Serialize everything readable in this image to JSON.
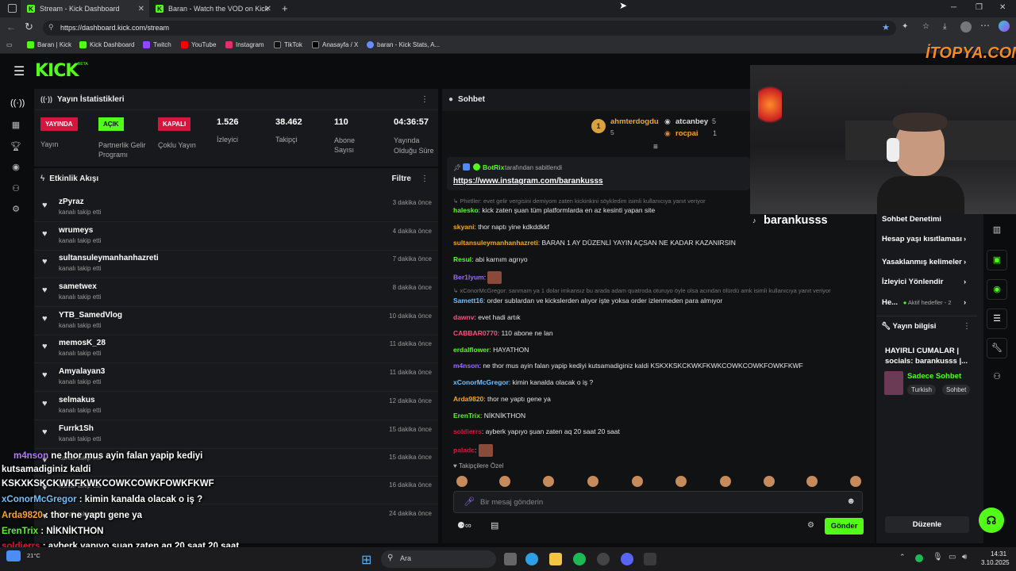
{
  "browser": {
    "tabs": [
      {
        "label": "Stream - Kick Dashboard"
      },
      {
        "label": "Baran - Watch the VOD on Kick"
      }
    ],
    "new_tab": "+",
    "url": "https://dashboard.kick.com/stream",
    "bookmarks": [
      "Baran | Kick",
      "Kick Dashboard",
      "Twitch",
      "YouTube",
      "Instagram",
      "TikTok",
      "Anasayfa / X",
      "baran - Kick Stats, A..."
    ]
  },
  "kick": {
    "logo": "KICK",
    "logo_sup": "BETA"
  },
  "stats_panel": {
    "title": "Yayın İstatistikleri",
    "items": [
      {
        "badge": "YAYINDA",
        "label": "Yayın",
        "color": "#d4153c"
      },
      {
        "badge": "AÇIK",
        "label": "Partnerlik Gelir Programı",
        "color": "#53fc18"
      },
      {
        "badge": "KAPALI",
        "label": "Çoklu Yayın",
        "color": "#d4153c"
      },
      {
        "value": "1.526",
        "label": "İzleyici"
      },
      {
        "value": "38.462",
        "label": "Takipçi"
      },
      {
        "value": "110",
        "label": "Abone Sayısı"
      },
      {
        "value": "04:36:57",
        "label": "Yayında Olduğu Süre"
      }
    ]
  },
  "activity": {
    "title": "Etkinlik Akışı",
    "filter": "Filtre",
    "sub": "kanalı takip etti",
    "items": [
      {
        "name": "zPyraz",
        "time": "3 dakika önce"
      },
      {
        "name": "wrumeys",
        "time": "4 dakika önce"
      },
      {
        "name": "sultansuleymanhanhazreti",
        "time": "7 dakika önce"
      },
      {
        "name": "sametwex",
        "time": "8 dakika önce"
      },
      {
        "name": "YTB_SamedVlog",
        "time": "10 dakika önce"
      },
      {
        "name": "memosK_28",
        "time": "11 dakika önce"
      },
      {
        "name": "Amyalayan3",
        "time": "11 dakika önce"
      },
      {
        "name": "selmakus",
        "time": "12 dakika önce"
      },
      {
        "name": "Furrk1Sh",
        "time": "15 dakika önce"
      },
      {
        "name": "",
        "time": "15 dakika önce"
      },
      {
        "name": "",
        "time": "16 dakika önce"
      },
      {
        "name": "",
        "time": "24 dakika önce"
      }
    ]
  },
  "chat": {
    "title": "Sohbet",
    "top": [
      {
        "rank": "1",
        "name": "ahmterdogdu",
        "count": "5"
      },
      {
        "name": "atcanbey",
        "count": "5"
      },
      {
        "name": "rocpai",
        "count": "1"
      }
    ],
    "pinned_by": "BotRix",
    "pinned_suffix": "tarafından sabitlendi",
    "pinned_link": "https://www.instagram.com/barankusss",
    "messages": [
      {
        "type": "reply",
        "text": "Phirtller: evet gelir vergisini demiyom zaten kickinkini söykledim isimli kullanıcıya yanıt veriyor"
      },
      {
        "user": "halesko",
        "color": "#53fc18",
        "text": "kick zaten şuan tüm platformlarda en az kesinti yapan site"
      },
      {
        "user": "skyani",
        "color": "#f5a623",
        "text": "thor naptı yine kdkddkkf"
      },
      {
        "user": "sultansuleymanhanhazreti",
        "color": "#f5a623",
        "text": "BARAN 1 AY DÜZENLİ YAYIN AÇSAN NE KADAR KAZANIRSIN"
      },
      {
        "user": "Resul",
        "color": "#53fc18",
        "text": "abi karnım agrıyo"
      },
      {
        "user": "Ber1lyum",
        "color": "#9b6cff",
        "text": ""
      },
      {
        "type": "reply",
        "text": "xConorMcGregor: sanmam ya 1 dolar imkansız bu arada adam quatroda oturuyo öyle olsa acından ölürdü amk isimli kullanıcıya yanıt veriyor"
      },
      {
        "user": "Samett16",
        "color": "#6ec1ff",
        "text": "order sublardan ve kickslerden alıyor işte yoksa order izlenmeden para almıyor"
      },
      {
        "user": "dawnv",
        "color": "#ff4f81",
        "text": "evet hadi artık"
      },
      {
        "user": "CABBAR0770",
        "color": "#ff4f81",
        "text": "110 abone ne lan"
      },
      {
        "user": "erdalflower",
        "color": "#53fc18",
        "text": "HAYATHON"
      },
      {
        "user": "m4nson",
        "color": "#9b6cff",
        "text": "ne thor mus ayin falan yapip kediyi kutsamadiginiz kaldi KSKXKSKCKWKFKWKCOWKCOWKFOWKFKWF"
      },
      {
        "user": "xConorMcGregor",
        "color": "#6ec1ff",
        "text": "kimin kanalda olacak o iş ?"
      },
      {
        "user": "Arda9820",
        "color": "#f5a623",
        "text": "thor ne yaptı gene ya"
      },
      {
        "user": "ErenTrix",
        "color": "#53fc18",
        "text": "NİKNİKTHON"
      },
      {
        "user": "soldierrs",
        "color": "#d4153c",
        "text": "ayberk yapıyo şuan zaten aq 20 saat 20 saat"
      },
      {
        "user": "paladc",
        "color": "#d4153c",
        "text": ""
      }
    ],
    "followers_only": "Takipçilere Özel",
    "input_placeholder": "Bir mesaj gönderin",
    "send": "Gönder"
  },
  "webcam": {
    "name": "barankusss",
    "banner": "İTOPYA.COM"
  },
  "right_panel": {
    "menu": [
      {
        "label": "Sohbet Denetimi"
      },
      {
        "label": "Hesap yaşı kısıtlaması"
      },
      {
        "label": "Yasaklanmış kelimeler"
      },
      {
        "label": "İzleyici Yönlendir"
      },
      {
        "label": "He...",
        "extra": "Aktif hedefler - 2"
      }
    ],
    "stream_info_title": "Yayın bilgisi",
    "stream_title": "HAYIRLI CUMALAR | socials: barankusss |...",
    "category": "Sadece Sohbet",
    "tags": [
      "Turkish",
      "Sohbet"
    ],
    "edit": "Düzenle"
  },
  "overlay_chat": [
    {
      "user": "m4nson",
      "color": "#b57cff",
      "text": "ne thor mus ayin falan yapip kediyi"
    },
    {
      "user": "",
      "text": "kutsamadiginiz kaldi"
    },
    {
      "user": "",
      "text": "KSKXKSKCKWKFKWKCOWKCOWKFOWKFKWF"
    },
    {
      "user": "xConorMcGregor",
      "color": "#6ec1ff",
      "text": ": kimin kanalda olacak o iş ?"
    },
    {
      "user": "Arda9820",
      "color": "#f5a623",
      "text": ": thor ne yaptı gene ya"
    },
    {
      "user": "ErenTrix",
      "color": "#53fc18",
      "text": ": NİKNİKTHON"
    },
    {
      "user": "soldierrs",
      "color": "#d4153c",
      "text": ": ayberk yapıyo şuan zaten aq 20 saat 20 saat"
    },
    {
      "user": "paladc",
      "color": "#d4153c",
      "text": ""
    }
  ],
  "taskbar": {
    "search": "Ara",
    "weather": "21°C",
    "time": "14:31",
    "date": "3.10.2025"
  }
}
